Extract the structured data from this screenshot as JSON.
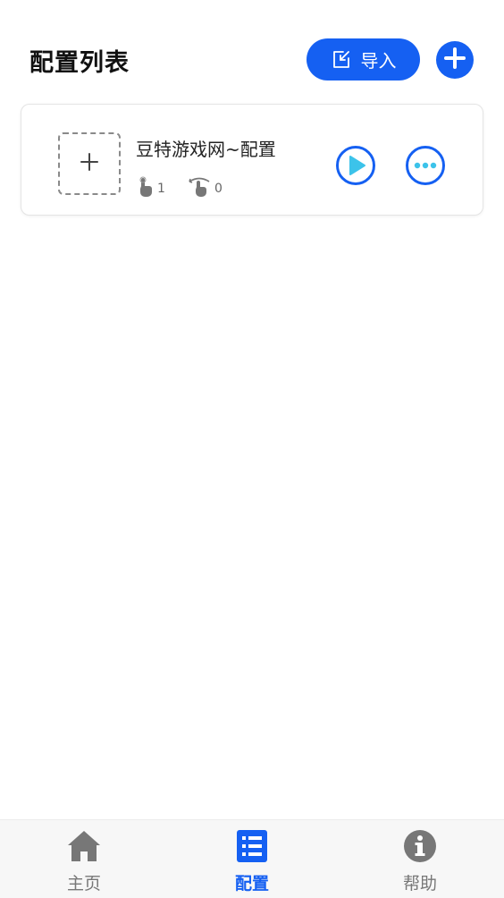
{
  "header": {
    "title": "配置列表",
    "import_label": "导入",
    "import_icon": "import-icon",
    "add_icon": "plus-icon"
  },
  "configs": [
    {
      "name": "豆特游戏网~配置",
      "thumbnail_icon": "plus-icon",
      "tap_count": "1",
      "swipe_count": "0"
    }
  ],
  "bottom_nav": {
    "items": [
      {
        "label": "主页",
        "icon": "home-icon",
        "active": false
      },
      {
        "label": "配置",
        "icon": "list-icon",
        "active": true
      },
      {
        "label": "帮助",
        "icon": "info-icon",
        "active": false
      }
    ]
  },
  "colors": {
    "accent": "#1560f2",
    "play_fill": "#3cc3ea",
    "inactive": "#777777"
  }
}
